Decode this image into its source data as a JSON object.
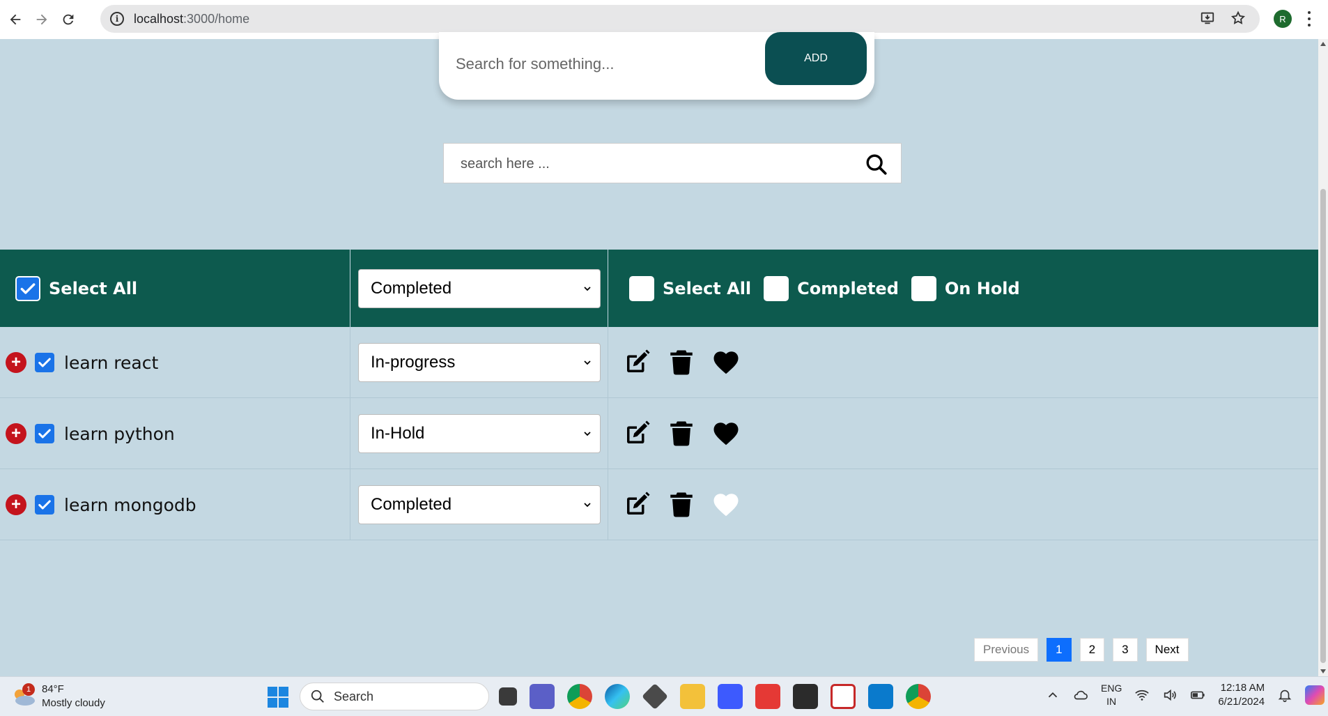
{
  "browser": {
    "url_host": "localhost",
    "url_path": ":3000/home",
    "profile_initial": "R"
  },
  "add_form": {
    "placeholder": "Search for something...",
    "add_label": "ADD"
  },
  "search": {
    "placeholder": "search here ..."
  },
  "table": {
    "header": {
      "select_all_label": "Select All",
      "select_all_checked": true,
      "bulk_status": "Completed",
      "filters": [
        {
          "label": "Select All",
          "checked": false
        },
        {
          "label": "Completed",
          "checked": false
        },
        {
          "label": "On Hold",
          "checked": false
        }
      ]
    },
    "rows": [
      {
        "task": "learn react",
        "checked": true,
        "status": "In-progress",
        "favorite": true
      },
      {
        "task": "learn python",
        "checked": true,
        "status": "In-Hold",
        "favorite": true
      },
      {
        "task": "learn mongodb",
        "checked": true,
        "status": "Completed",
        "favorite": false
      }
    ]
  },
  "pagination": {
    "previous_label": "Previous",
    "pages": [
      "1",
      "2",
      "3"
    ],
    "active_page": "1",
    "next_label": "Next"
  },
  "taskbar": {
    "weather_temp": "84°F",
    "weather_desc": "Mostly cloudy",
    "weather_badge": "1",
    "search_label": "Search",
    "lang_1": "ENG",
    "lang_2": "IN",
    "time": "12:18 AM",
    "date": "6/21/2024"
  },
  "colors": {
    "page_bg": "#c4d8e2",
    "header_bg": "#0d5a4e",
    "add_button": "#0b4f52",
    "checkbox_blue": "#1a73e8",
    "plus_red": "#c4141d",
    "active_page": "#0d6efd"
  }
}
